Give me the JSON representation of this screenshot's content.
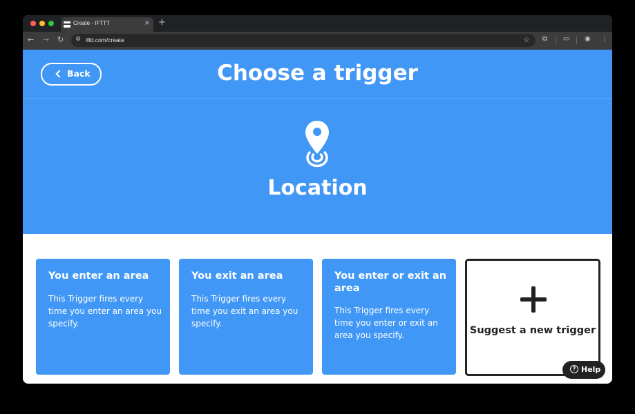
{
  "browser": {
    "tab_title": "Create - IFTTT",
    "tab_close": "×",
    "new_tab": "+",
    "url": "ifttt.com/create",
    "nav_back": "←",
    "nav_forward": "→",
    "nav_reload": "↻",
    "star": "☆"
  },
  "header": {
    "back_label": "Back",
    "title": "Choose a trigger"
  },
  "service": {
    "name": "Location",
    "icon": "location-pin-icon",
    "brand_color": "#4197f5"
  },
  "triggers": [
    {
      "title": "You enter an area",
      "description": "This Trigger fires every time you enter an area you specify."
    },
    {
      "title": "You exit an area",
      "description": "This Trigger fires every time you exit an area you specify."
    },
    {
      "title": "You enter or exit an area",
      "description": "This Trigger fires every time you enter or exit an area you specify."
    }
  ],
  "suggest": {
    "label": "Suggest a new trigger"
  },
  "help": {
    "label": "Help",
    "icon_glyph": "?"
  }
}
